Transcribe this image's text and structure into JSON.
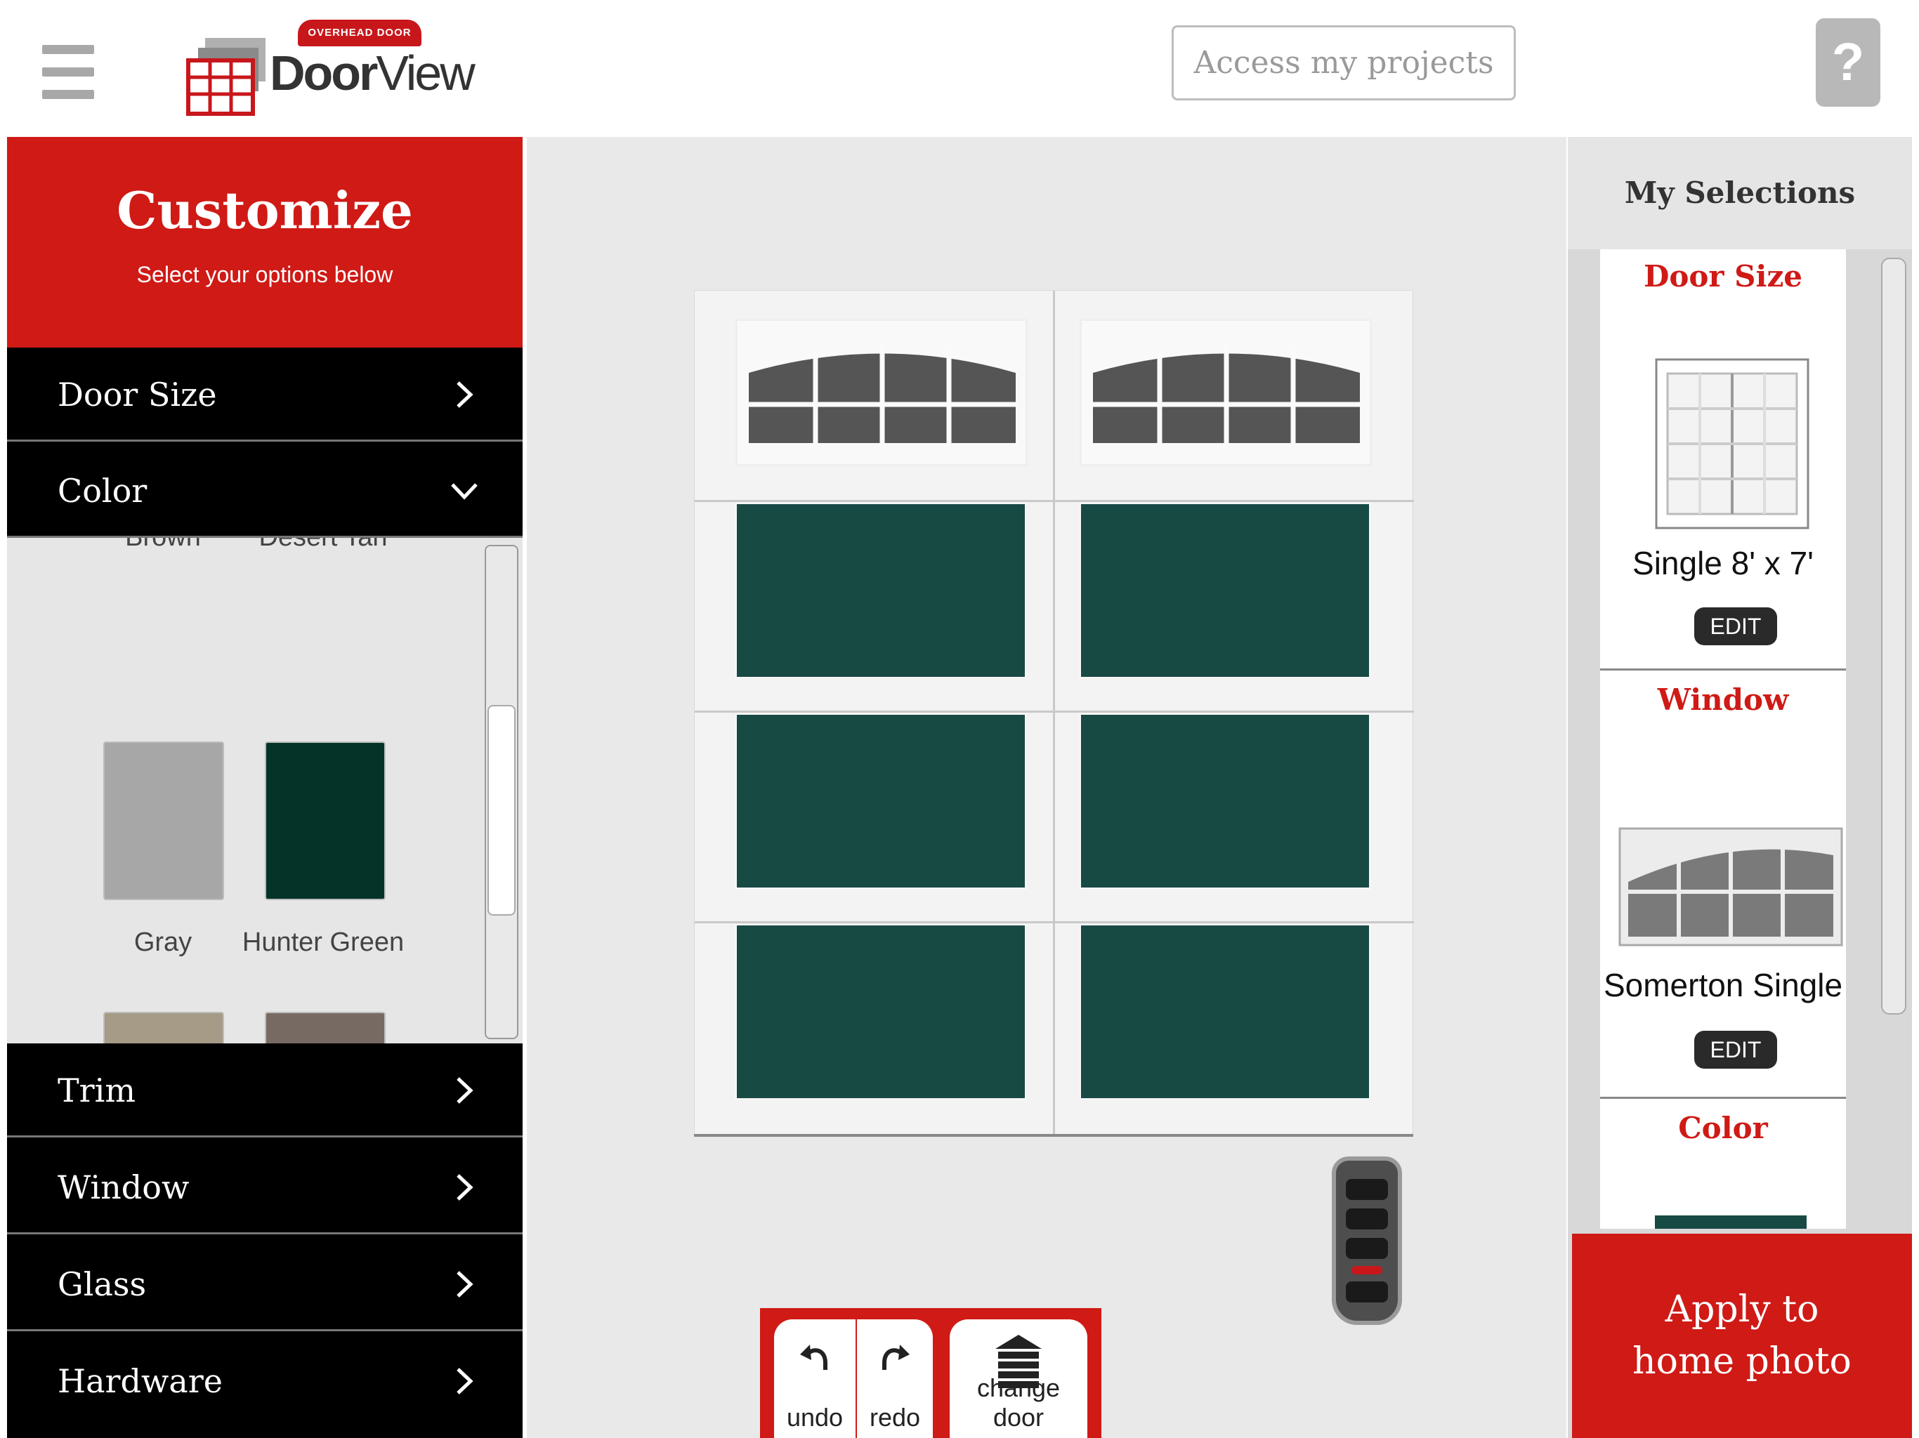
{
  "header": {
    "logo_ribbon": "OVERHEAD DOOR",
    "logo_door": "Door",
    "logo_view": "View",
    "access_button": "Access my projects",
    "help_button": "?"
  },
  "customize": {
    "title": "Customize",
    "subtitle": "Select your options below",
    "sections": {
      "door_size": "Door Size",
      "color": "Color",
      "trim": "Trim",
      "window": "Window",
      "glass": "Glass",
      "hardware": "Hardware"
    },
    "colors_cut": [
      "Brown",
      "Desert Tan"
    ],
    "colors": [
      {
        "name": "Gray",
        "hex": "#a7a7a7"
      },
      {
        "name": "Hunter Green",
        "hex": "#033427"
      },
      {
        "name": "",
        "hex": "#a59b86"
      },
      {
        "name": "",
        "hex": "#776a62"
      }
    ]
  },
  "preview": {
    "door_color": "#184a44",
    "toolbar": {
      "undo": "undo",
      "redo": "redo",
      "change_door": "change door"
    }
  },
  "selections": {
    "title": "My Selections",
    "items": [
      {
        "title": "Door Size",
        "value": "Single 8' x 7'",
        "edit": "EDIT"
      },
      {
        "title": "Window",
        "value": "Somerton Single",
        "edit": "EDIT"
      },
      {
        "title": "Color"
      }
    ],
    "apply_line1": "Apply to",
    "apply_line2": "home photo"
  },
  "colors": {
    "brand_red": "#cf1a16",
    "panel_black": "#000000"
  }
}
